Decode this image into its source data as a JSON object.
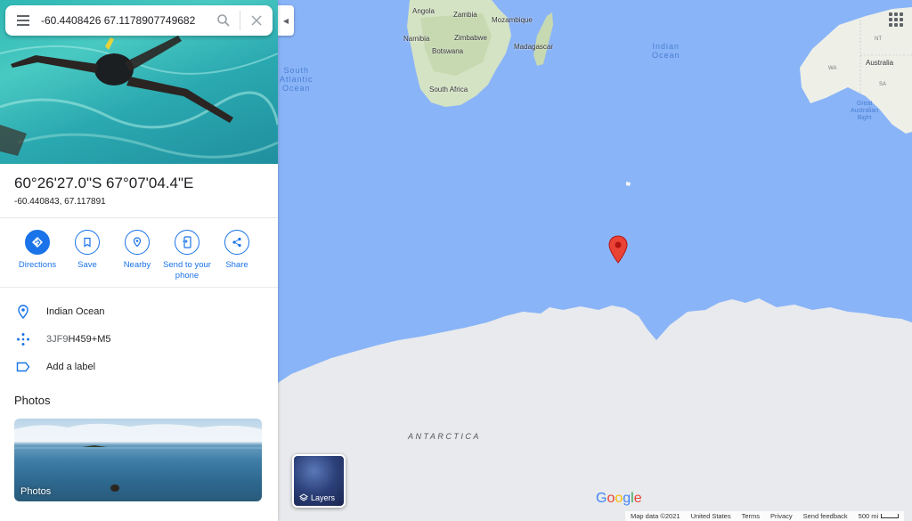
{
  "search": {
    "query": "-60.4408426 67.1178907749682"
  },
  "place": {
    "title": "60°26'27.0\"S 67°07'04.4\"E",
    "decimal": "-60.440843, 67.117891"
  },
  "actions": [
    {
      "label": "Directions",
      "icon": "directions-icon"
    },
    {
      "label": "Save",
      "icon": "bookmark-icon"
    },
    {
      "label": "Nearby",
      "icon": "nearby-icon"
    },
    {
      "label": "Send to your phone",
      "icon": "send-to-phone-icon"
    },
    {
      "label": "Share",
      "icon": "share-icon"
    }
  ],
  "info": {
    "location": "Indian Ocean",
    "plus_code_prefix": "3JF9",
    "plus_code_suffix": "H459+M5",
    "add_label": "Add a label"
  },
  "photos": {
    "title": "Photos",
    "card_caption": "Photos"
  },
  "map": {
    "labels": {
      "angola": "Angola",
      "zambia": "Zambia",
      "mozambique": "Mozambique",
      "namibia": "Namibia",
      "zimbabwe": "Zimbabwe",
      "botswana": "Botswana",
      "madagascar": "Madagascar",
      "south_africa": "South Africa",
      "south_atlantic_1": "South",
      "south_atlantic_2": "Atlantic",
      "south_atlantic_3": "Ocean",
      "indian_ocean_1": "Indian",
      "indian_ocean_2": "Ocean",
      "australia": "Australia",
      "nt": "NT",
      "qld": "QLD",
      "wa": "WA",
      "sa": "SA",
      "bight_1": "Great",
      "bight_2": "Australian",
      "bight_3": "Bight",
      "antarctica": "ANTARCTICA"
    },
    "layers_label": "Layers",
    "logo": "Google",
    "footer": {
      "map_data": "Map data ©2021",
      "region": "United States",
      "terms": "Terms",
      "privacy": "Privacy",
      "feedback": "Send feedback",
      "scale": "500 mi"
    },
    "colors": {
      "water": "#8ab4f8",
      "land": "#e8eaed",
      "africa_green": "#c8dcb4",
      "pin": "#ea4335",
      "accent": "#1a73e8"
    }
  }
}
